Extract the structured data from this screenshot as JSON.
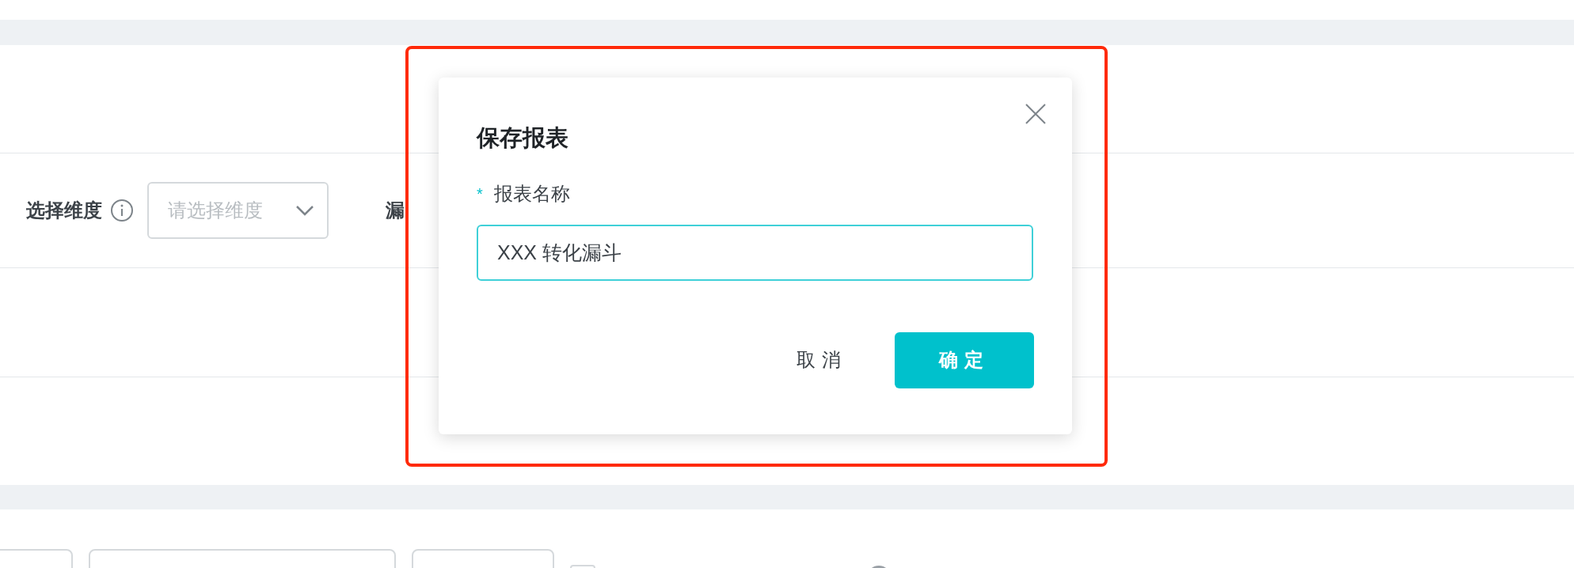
{
  "filter": {
    "label": "选择维度",
    "select_placeholder": "请选择维度",
    "next_label": "漏"
  },
  "dialog": {
    "title": "保存报表",
    "field": {
      "required_mark": "*",
      "label": "报表名称",
      "value": "XXX 转化漏斗"
    },
    "buttons": [
      {
        "label": "取消",
        "kind": "secondary"
      },
      {
        "label": "确定",
        "kind": "primary"
      }
    ]
  },
  "toolbar": {
    "checkbox": {
      "checked": false
    }
  }
}
